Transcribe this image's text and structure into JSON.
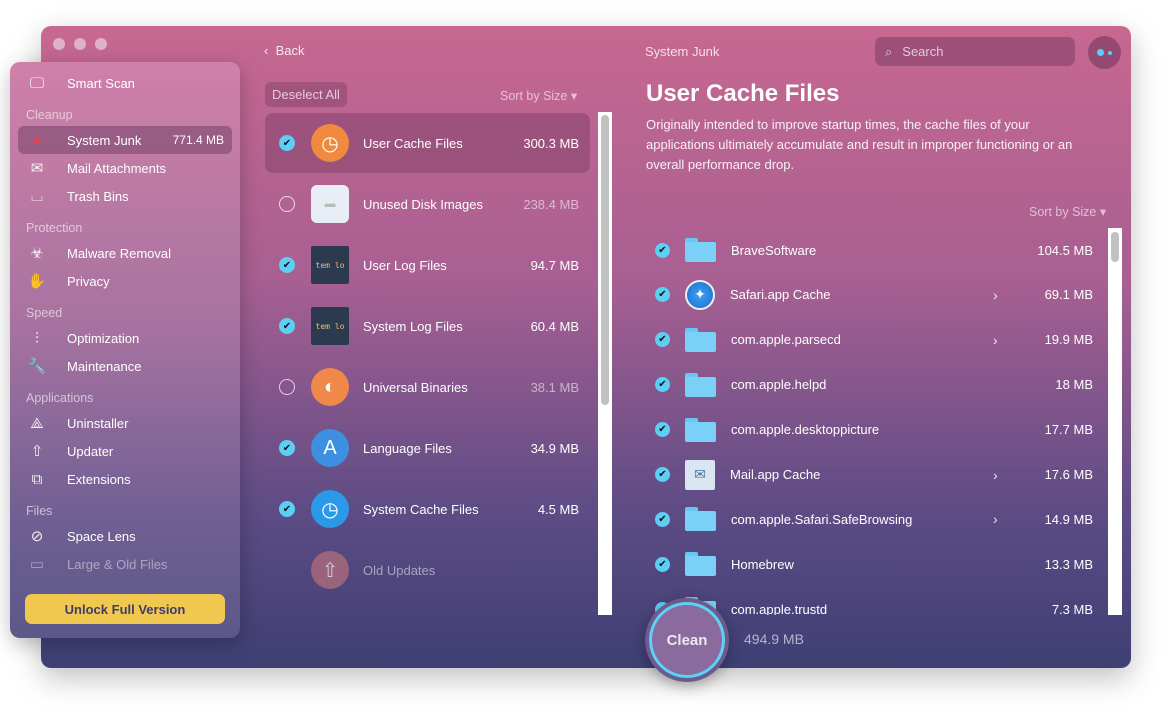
{
  "window": {
    "title": "System Junk",
    "back_label": "Back",
    "search_placeholder": "Search"
  },
  "colors": {
    "accent": "#5ccff5",
    "unlock": "#f0c84f"
  },
  "sidebar": {
    "items": [
      {
        "label": "Smart Scan",
        "icon": "monitor-icon",
        "glyph": "🖵"
      },
      {
        "label": "System Junk",
        "icon": "system-junk-icon",
        "glyph": "●",
        "size": "771.4 MB",
        "selected": true
      },
      {
        "label": "Mail Attachments",
        "icon": "envelope-icon",
        "glyph": "✉"
      },
      {
        "label": "Trash Bins",
        "icon": "trash-icon",
        "glyph": "⌴"
      },
      {
        "label": "Malware Removal",
        "icon": "biohazard-icon",
        "glyph": "☣"
      },
      {
        "label": "Privacy",
        "icon": "hand-icon",
        "glyph": "✋"
      },
      {
        "label": "Optimization",
        "icon": "sliders-icon",
        "glyph": "⫶"
      },
      {
        "label": "Maintenance",
        "icon": "wrench-icon",
        "glyph": "🔧"
      },
      {
        "label": "Uninstaller",
        "icon": "uninstaller-icon",
        "glyph": "⟁"
      },
      {
        "label": "Updater",
        "icon": "updater-icon",
        "glyph": "⇧"
      },
      {
        "label": "Extensions",
        "icon": "puzzle-icon",
        "glyph": "⧉"
      },
      {
        "label": "Space Lens",
        "icon": "planet-icon",
        "glyph": "⊘"
      },
      {
        "label": "Large & Old Files",
        "icon": "folder-icon",
        "glyph": "▭"
      }
    ],
    "sections": [
      "Cleanup",
      "Protection",
      "Speed",
      "Applications",
      "Files"
    ],
    "unlock_label": "Unlock Full Version"
  },
  "middle": {
    "deselect_label": "Deselect All",
    "sort_label": "Sort by Size ▾",
    "items": [
      {
        "label": "User Cache Files",
        "size": "300.3 MB",
        "checked": "on",
        "icon": "user-cache-icon",
        "glyph": "◷",
        "bg": "#f08a3e",
        "selected": true
      },
      {
        "label": "Unused Disk Images",
        "size": "238.4 MB",
        "checked": "off",
        "icon": "disk-image-icon",
        "glyph": "▬",
        "bg": "#e8eef5"
      },
      {
        "label": "User Log Files",
        "size": "94.7 MB",
        "checked": "on",
        "icon": "user-log-icon",
        "glyph": "tem lo",
        "bg": "#2c3a50"
      },
      {
        "label": "System Log Files",
        "size": "60.4 MB",
        "checked": "on",
        "icon": "system-log-icon",
        "glyph": "tem lo",
        "bg": "#2c3a50"
      },
      {
        "label": "Universal Binaries",
        "size": "38.1 MB",
        "checked": "off",
        "icon": "universal-binaries-icon",
        "glyph": "◐",
        "bg": "#f0884a"
      },
      {
        "label": "Language Files",
        "size": "34.9 MB",
        "checked": "on",
        "icon": "language-flag-icon",
        "glyph": "A",
        "bg": "#3d8fe0"
      },
      {
        "label": "System Cache Files",
        "size": "4.5 MB",
        "checked": "on",
        "icon": "system-cache-icon",
        "glyph": "◷",
        "bg": "#2a9ae8"
      },
      {
        "label": "Old Updates",
        "size": "",
        "checked": "none",
        "icon": "old-updates-icon",
        "glyph": "⇧",
        "bg": "#b9707a",
        "dim": true
      }
    ]
  },
  "detail": {
    "title": "User Cache Files",
    "description": "Originally intended to improve startup times, the cache files of your applications ultimately accumulate and result in improper functioning or an overall performance drop.",
    "sort_label": "Sort by Size ▾",
    "items": [
      {
        "label": "BraveSoftware",
        "size": "104.5 MB",
        "type": "folder",
        "chevron": false
      },
      {
        "label": "Safari.app Cache",
        "size": "69.1 MB",
        "type": "safari",
        "chevron": true
      },
      {
        "label": "com.apple.parsecd",
        "size": "19.9 MB",
        "type": "folder",
        "chevron": true
      },
      {
        "label": "com.apple.helpd",
        "size": "18 MB",
        "type": "folder",
        "chevron": false
      },
      {
        "label": "com.apple.desktoppicture",
        "size": "17.7 MB",
        "type": "folder",
        "chevron": false
      },
      {
        "label": "Mail.app Cache",
        "size": "17.6 MB",
        "type": "mail",
        "chevron": true
      },
      {
        "label": "com.apple.Safari.SafeBrowsing",
        "size": "14.9 MB",
        "type": "folder",
        "chevron": true
      },
      {
        "label": "Homebrew",
        "size": "13.3 MB",
        "type": "folder",
        "chevron": false
      },
      {
        "label": "com.apple.trustd",
        "size": "7.3 MB",
        "type": "folder",
        "chevron": false
      }
    ]
  },
  "footer": {
    "clean_label": "Clean",
    "total": "494.9 MB"
  }
}
